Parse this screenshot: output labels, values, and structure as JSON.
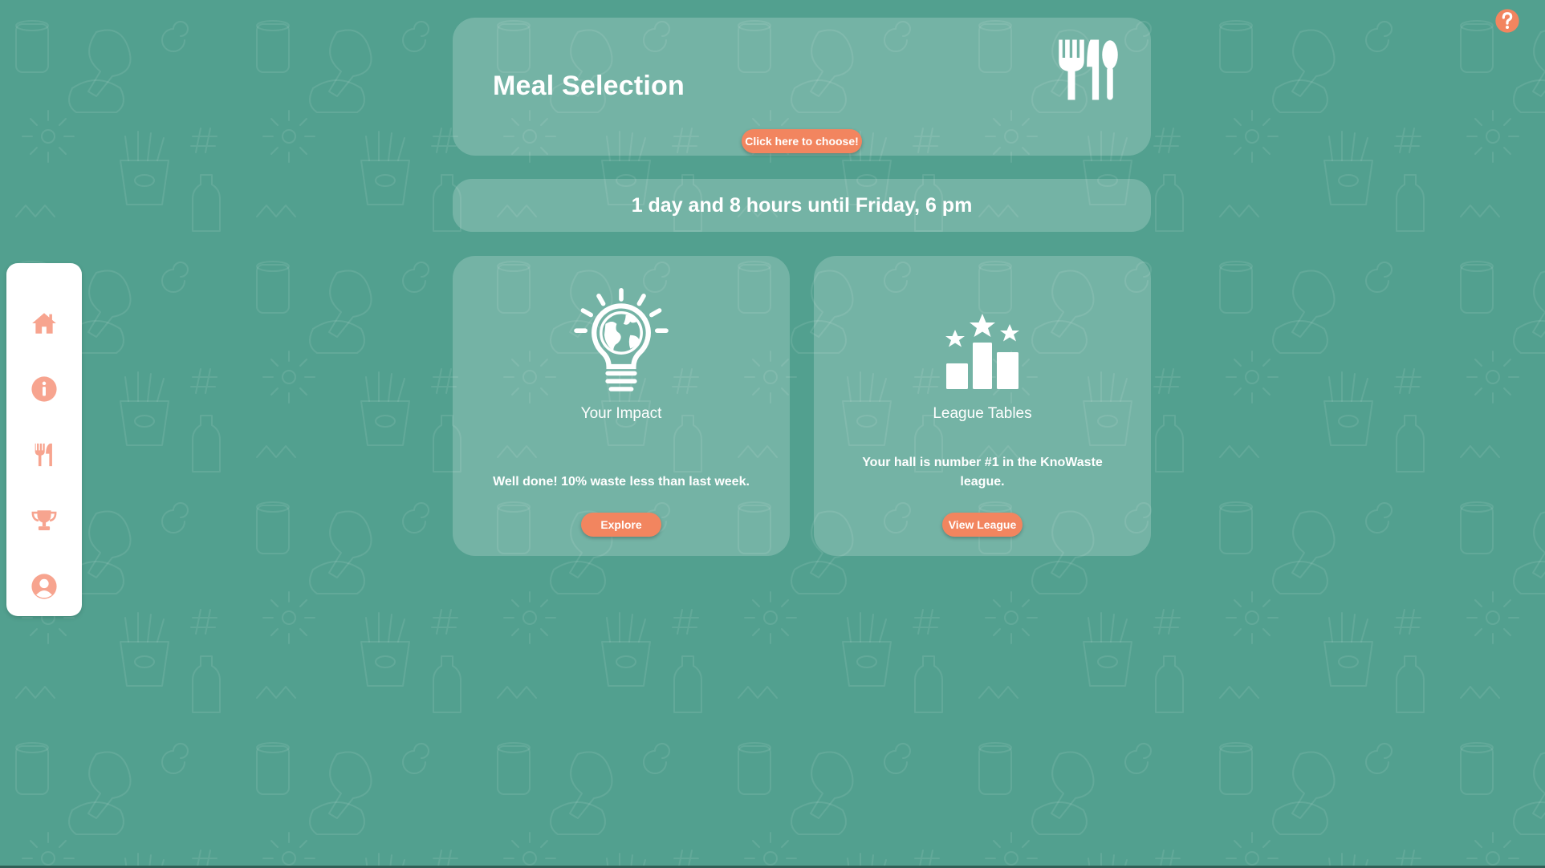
{
  "colors": {
    "background": "#52a08f",
    "accent": "#f2855f",
    "sidebar_icon": "#f7a48f",
    "card": "rgba(255,255,255,0.20)",
    "text": "#ffffff"
  },
  "sidebar": {
    "items": [
      {
        "icon": "home-icon"
      },
      {
        "icon": "info-icon"
      },
      {
        "icon": "cutlery-icon"
      },
      {
        "icon": "trophy-icon"
      },
      {
        "icon": "user-icon"
      }
    ]
  },
  "help": {
    "icon": "help-icon"
  },
  "meal_card": {
    "title": "Meal Selection",
    "button_label": "Click here to choose!",
    "icon": "cutlery-icon"
  },
  "countdown": {
    "text": "1 day and 8 hours until Friday, 6 pm"
  },
  "impact_card": {
    "icon": "lightbulb-globe-icon",
    "title": "Your Impact",
    "description": "Well done! 10% waste less than last week.",
    "button_label": "Explore"
  },
  "league_card": {
    "icon": "podium-stars-icon",
    "title": "League Tables",
    "description": "Your hall is number #1 in the KnoWaste league.",
    "button_label": "View League"
  }
}
